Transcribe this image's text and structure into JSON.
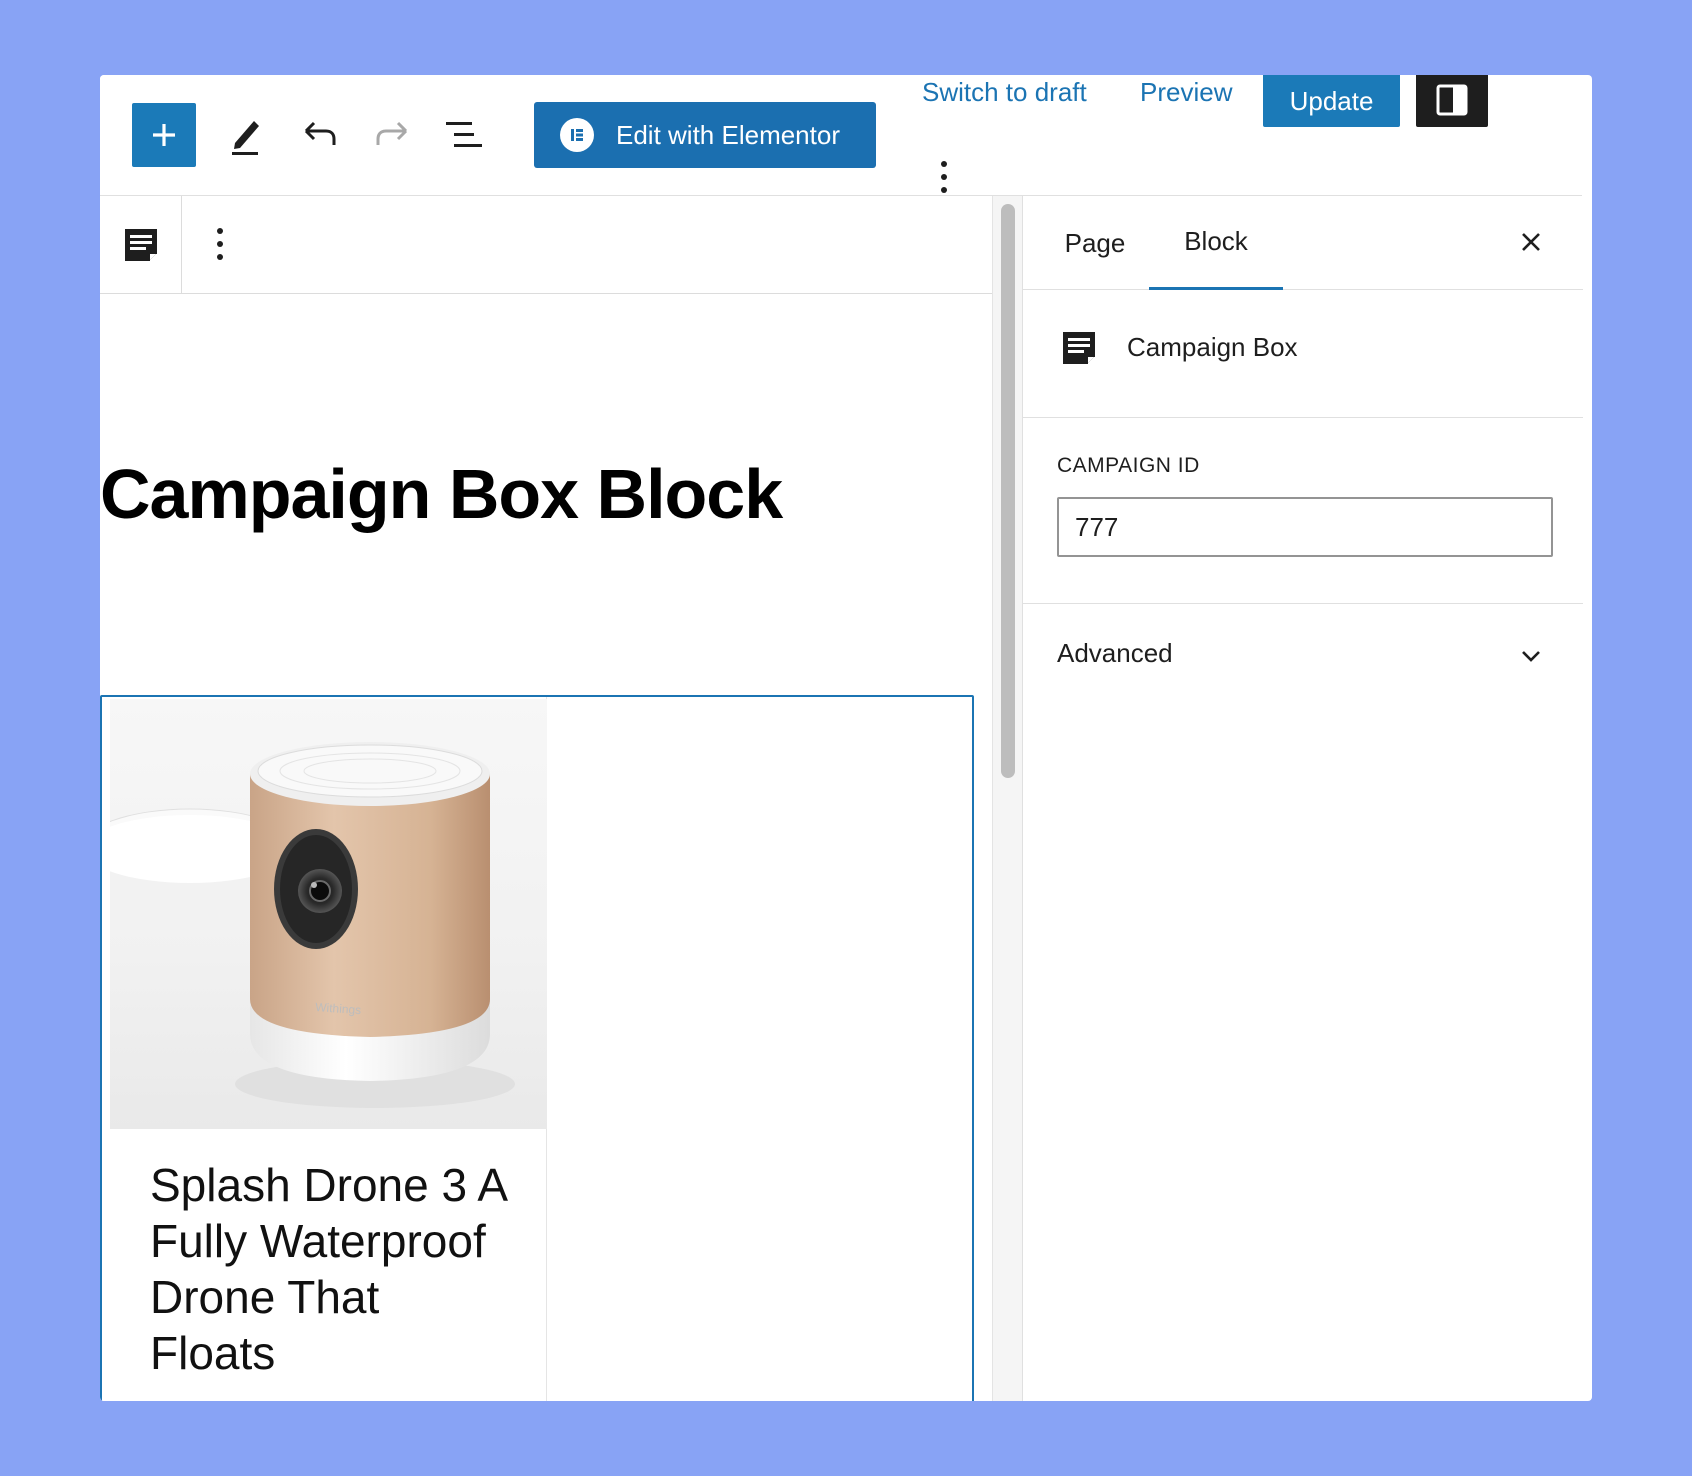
{
  "toolbar": {
    "add_label": "+",
    "edit_elementor_label": "Edit with Elementor",
    "switch_to_draft_label": "Switch to draft",
    "preview_label": "Preview",
    "update_label": "Update"
  },
  "editor": {
    "page_title": "Campaign Box Block",
    "campaign_card": {
      "title": "Splash Drone 3 A Fully Waterproof Drone That Floats",
      "image_brand_text": "Withings"
    }
  },
  "sidebar": {
    "tabs": [
      {
        "label": "Page"
      },
      {
        "label": "Block"
      }
    ],
    "active_tab": "Block",
    "block_name": "Campaign Box",
    "field_label": "CAMPAIGN ID",
    "field_value": "777",
    "advanced_label": "Advanced"
  },
  "colors": {
    "accent": "#1b7ab8",
    "link": "#1b74b3",
    "background": "#88a3f5",
    "dark_button": "#1e1e1e"
  },
  "icons": {
    "add": "plus-icon",
    "tools": "pencil-icon",
    "undo": "undo-icon",
    "redo": "redo-icon",
    "outline": "list-view-icon",
    "elementor": "elementor-icon",
    "settings": "sidebar-toggle-icon",
    "more": "vertical-ellipsis-icon",
    "block": "post-excerpt-icon",
    "close": "close-icon",
    "chevron": "chevron-down-icon"
  }
}
